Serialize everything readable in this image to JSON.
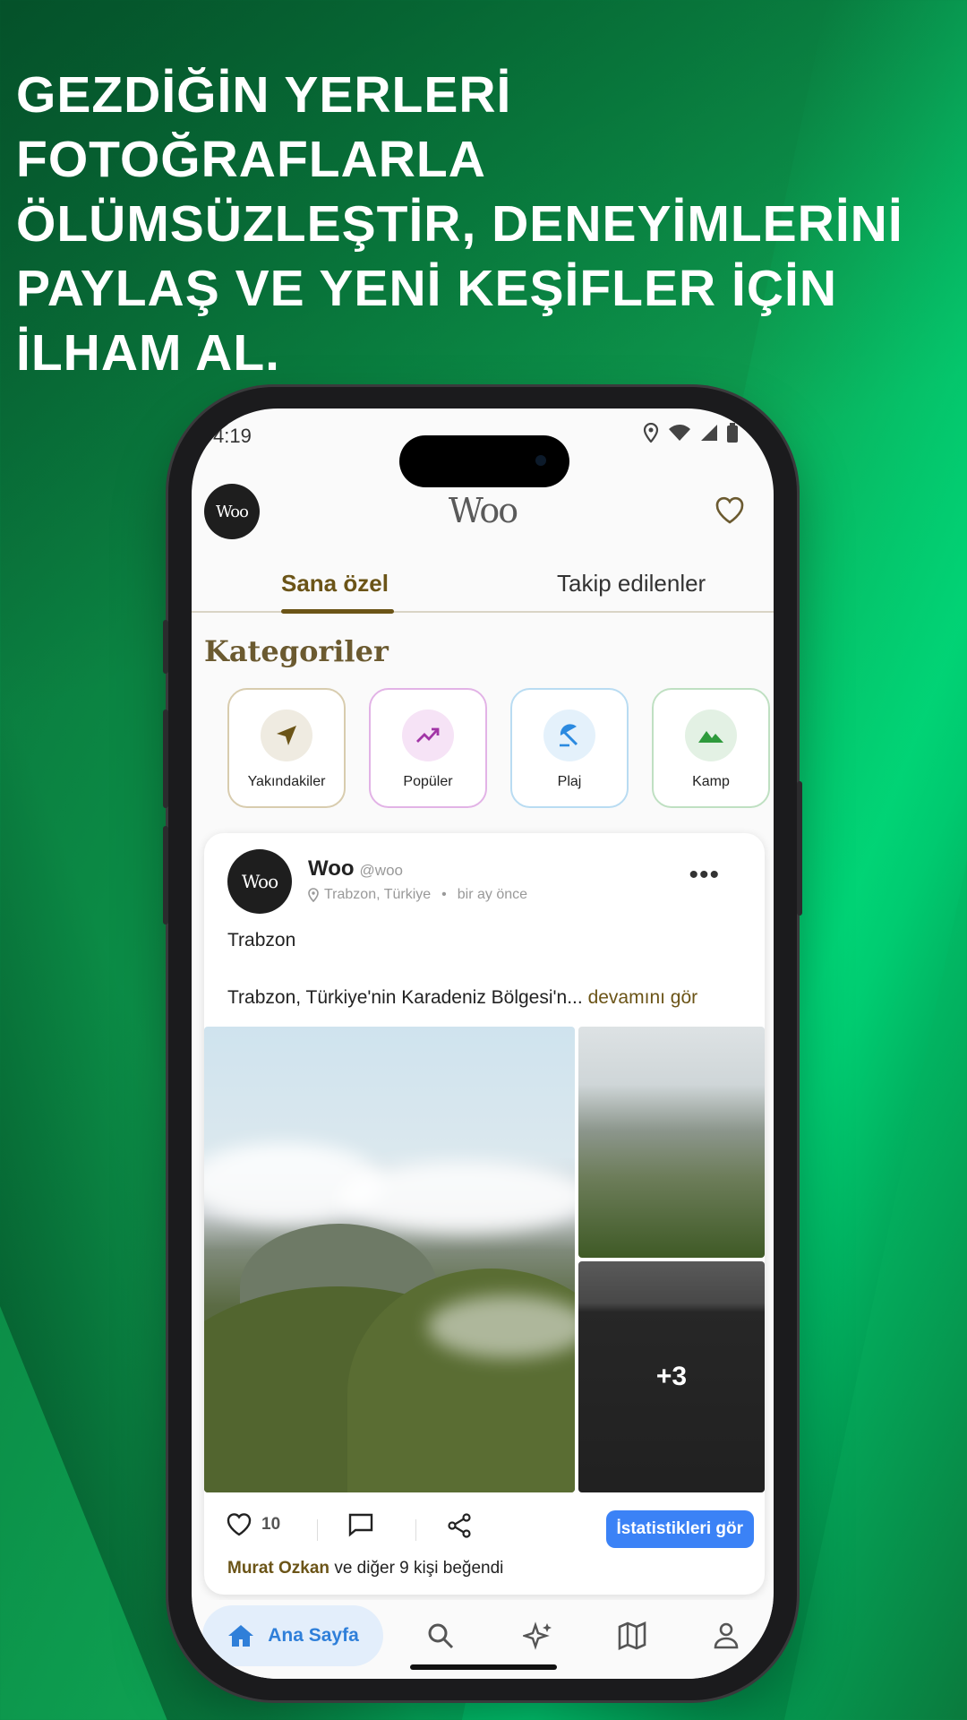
{
  "headline": {
    "lines": [
      "GEZDİĞİN YERLERİ FOTOĞRAFLARLA",
      "ÖLÜMSÜZLEŞTİR, DENEYİMLERİNİ",
      "PAYLAŞ VE YENİ KEŞİFLER İÇİN",
      "İLHAM AL."
    ]
  },
  "status": {
    "time": "4:19"
  },
  "header": {
    "avatar_text": "Woo",
    "brand": "Woo"
  },
  "tabs": [
    {
      "label": "Sana özel",
      "active": true
    },
    {
      "label": "Takip edilenler",
      "active": false
    }
  ],
  "categories": {
    "title": "Kategoriler",
    "items": [
      {
        "label": "Yakındakiler",
        "color": "#d8ccae",
        "icon": "navigation-arrow-icon"
      },
      {
        "label": "Popüler",
        "color": "#e2b3e6",
        "icon": "trending-up-icon"
      },
      {
        "label": "Plaj",
        "color": "#b9dcf2",
        "icon": "beach-umbrella-icon"
      },
      {
        "label": "Kamp",
        "color": "#bfe0c2",
        "icon": "mountain-icon"
      }
    ]
  },
  "post": {
    "avatar_text": "Woo",
    "name": "Woo",
    "handle": "@woo",
    "location": "Trabzon, Türkiye",
    "time": "bir ay önce",
    "title": "Trabzon",
    "body": "Trabzon, Türkiye'nin Karadeniz Bölgesi'n...",
    "more_link": "devamını gör",
    "extra_photos": "+3",
    "like_count": "10",
    "stats_button": "İstatistikleri gör",
    "likes_user": "Murat Ozkan",
    "likes_rest": "ve diğer 9 kişi beğendi"
  },
  "nav": {
    "home_label": "Ana Sayfa"
  },
  "colors": {
    "accent": "#6b5417",
    "primary_blue": "#3b82f6",
    "nav_blue": "#2f7fd9"
  }
}
